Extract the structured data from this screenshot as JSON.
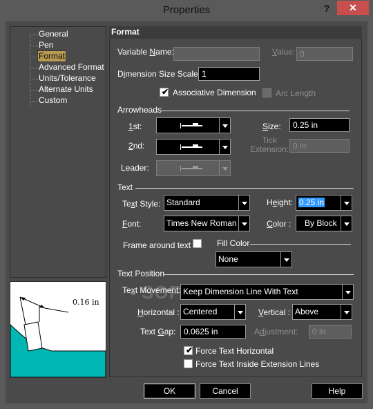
{
  "window": {
    "title": "Properties",
    "help_glyph": "?",
    "close_glyph": "✕"
  },
  "tree": {
    "items": [
      {
        "label": "General"
      },
      {
        "label": "Pen"
      },
      {
        "label": "Format",
        "selected": true
      },
      {
        "label": "Advanced Format"
      },
      {
        "label": "Units/Tolerance"
      },
      {
        "label": "Alternate Units"
      },
      {
        "label": "Custom"
      }
    ]
  },
  "preview": {
    "dimension_label": "0.16 in",
    "fill_color": "#00b7b3"
  },
  "format": {
    "header": "Format",
    "variable_name": {
      "label_pre": "Variable ",
      "label_u": "N",
      "label_post": "ame:",
      "value": ""
    },
    "value": {
      "label_pre": "",
      "label_u": "V",
      "label_post": "alue:",
      "value": "0"
    },
    "dimension_size_scale": {
      "label_pre": "D",
      "label_u": "i",
      "label_post": "mension Size Scale:",
      "value": "1"
    },
    "associative_dimension": {
      "label": "Associative Dimension",
      "checked": true
    },
    "arc_length": {
      "label": "Arc Length",
      "checked": false
    },
    "arrowheads": {
      "section": "Arrowheads",
      "first": {
        "label_pre": "",
        "label_u": "1",
        "label_post": "st:"
      },
      "second": {
        "label_pre": "",
        "label_u": "2",
        "label_post": "nd:"
      },
      "leader": {
        "label": "Leader:"
      },
      "size": {
        "label_pre": "",
        "label_u": "S",
        "label_post": "ize:",
        "value": "0.25 in"
      },
      "tick_extension": {
        "label_line1": "Tick",
        "label_line2": "Extension:",
        "value": "0 in"
      }
    },
    "text": {
      "section": "Text",
      "style": {
        "label_pre": "Te",
        "label_u": "x",
        "label_post": "t Style:",
        "value": "Standard"
      },
      "height": {
        "label_pre": "H",
        "label_u": "e",
        "label_post": "ight:",
        "value": "0.25 in"
      },
      "font": {
        "label_pre": "",
        "label_u": "F",
        "label_post": "ont:",
        "value": "Times New Roman"
      },
      "color": {
        "label_pre": "",
        "label_u": "C",
        "label_post": "olor :",
        "value": "By Block"
      },
      "frame_around_text": {
        "label": "Frame around text",
        "checked": false
      },
      "fill_color": {
        "label": "Fill Color",
        "value": "None"
      }
    },
    "text_position": {
      "section": "Text Position",
      "text_movement": {
        "label_pre": "Te",
        "label_u": "x",
        "label_post": "t Movement:",
        "value": "Keep Dimension Line With Text"
      },
      "horizontal": {
        "label_pre": "",
        "label_u": "H",
        "label_post": "orizontal :",
        "value": "Centered"
      },
      "vertical": {
        "label_pre": "",
        "label_u": "V",
        "label_post": "ertical :",
        "value": "Above"
      },
      "text_gap": {
        "label_pre": "Text ",
        "label_u": "G",
        "label_post": "ap:",
        "value": "0.0625 in"
      },
      "adjustment": {
        "label_pre": "A",
        "label_u": "d",
        "label_post": "justment:",
        "value": "0 in"
      },
      "force_text_horizontal": {
        "label": "Force Text Horizontal",
        "checked": true
      },
      "force_text_inside": {
        "label": "Force Text Inside Extension Lines",
        "checked": false
      }
    }
  },
  "buttons": {
    "ok": "OK",
    "cancel": "Cancel",
    "help": "Help"
  },
  "watermark": "SOFTPEDIA"
}
